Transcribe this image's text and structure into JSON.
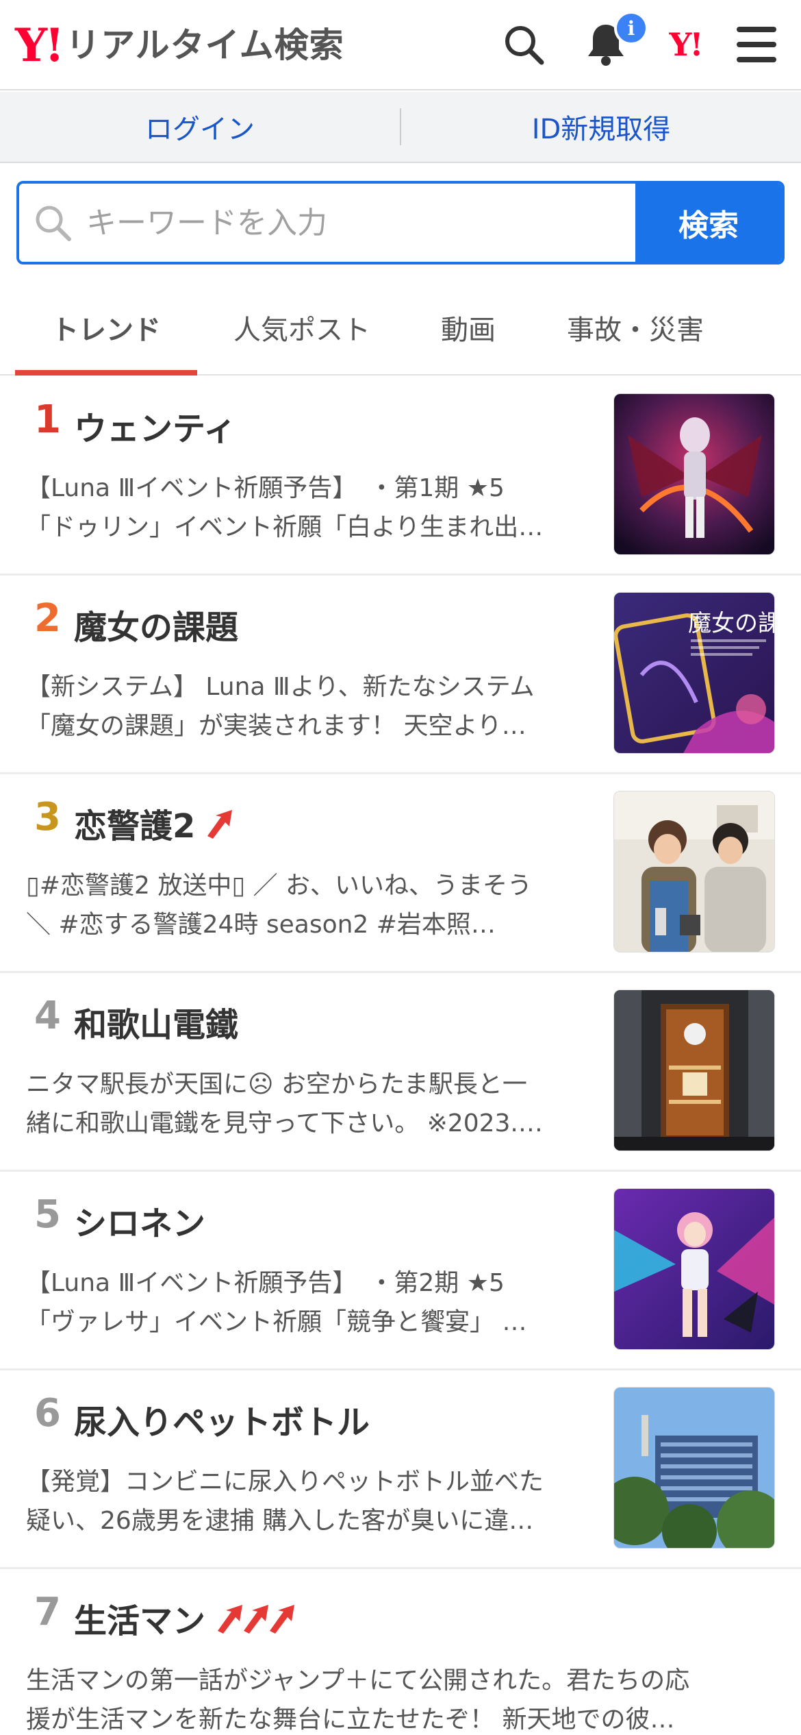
{
  "header": {
    "logo_mark": "Y!",
    "logo_text": "リアルタイム検索",
    "notification_badge": "i",
    "yahoo_link": "Y!"
  },
  "login_bar": {
    "login": "ログイン",
    "register": "ID新規取得"
  },
  "search": {
    "placeholder": "キーワードを入力",
    "button": "検索"
  },
  "tabs": [
    {
      "label": "トレンド",
      "active": true
    },
    {
      "label": "人気ポスト",
      "active": false
    },
    {
      "label": "動画",
      "active": false
    },
    {
      "label": "事故・災害",
      "active": false
    }
  ],
  "colors": {
    "accent_blue": "#1a73e8",
    "brand_red": "#ff0033",
    "rank1": "#d93a2b",
    "rank2": "#ef6c2f",
    "rank3": "#c8961e",
    "rank_other": "#999999",
    "trend_arrow": "#e53935"
  },
  "trends": [
    {
      "rank": "1",
      "title": "ウェンティ",
      "arrows": 0,
      "line1": "【Luna Ⅲイベント祈願予告】　・第1期 ★5",
      "line2": "「ドゥリン」イベント祈願「白より生まれ出…"
    },
    {
      "rank": "2",
      "title": "魔女の課題",
      "arrows": 0,
      "line1": "【新システム】 Luna Ⅲより、新たなシステム",
      "line2": "「魔女の課題」が実装されます！ 天空より…",
      "thumb_text": "魔女の課"
    },
    {
      "rank": "3",
      "title": "恋警護2",
      "arrows": 1,
      "line1": "▯#恋警護2 放送中▯ ／ お、いいね、うまそう",
      "line2": "＼ #恋する警護24時 season2 #岩本照…"
    },
    {
      "rank": "4",
      "title": "和歌山電鐵",
      "arrows": 0,
      "line1": "ニタマ駅長が天国に☹ お空からたま駅長と一",
      "line2": "緒に和歌山電鐵を見守って下さい。 ※2023.…"
    },
    {
      "rank": "5",
      "title": "シロネン",
      "arrows": 0,
      "line1": "【Luna Ⅲイベント祈願予告】　・第2期 ★5",
      "line2": "「ヴァレサ」イベント祈願「競争と饗宴」 …"
    },
    {
      "rank": "6",
      "title": "尿入りペットボトル",
      "arrows": 0,
      "line1": "【発覚】コンビニに尿入りペットボトル並べた",
      "line2": "疑い、26歳男を逮捕 購入した客が臭いに違…"
    },
    {
      "rank": "7",
      "title": "生活マン",
      "arrows": 3,
      "line1": "生活マンの第一話がジャンプ＋にて公開された。君たちの応",
      "line2": "援が生活マンを新たな舞台に立たせたぞ！ 新天地での彼…"
    }
  ]
}
